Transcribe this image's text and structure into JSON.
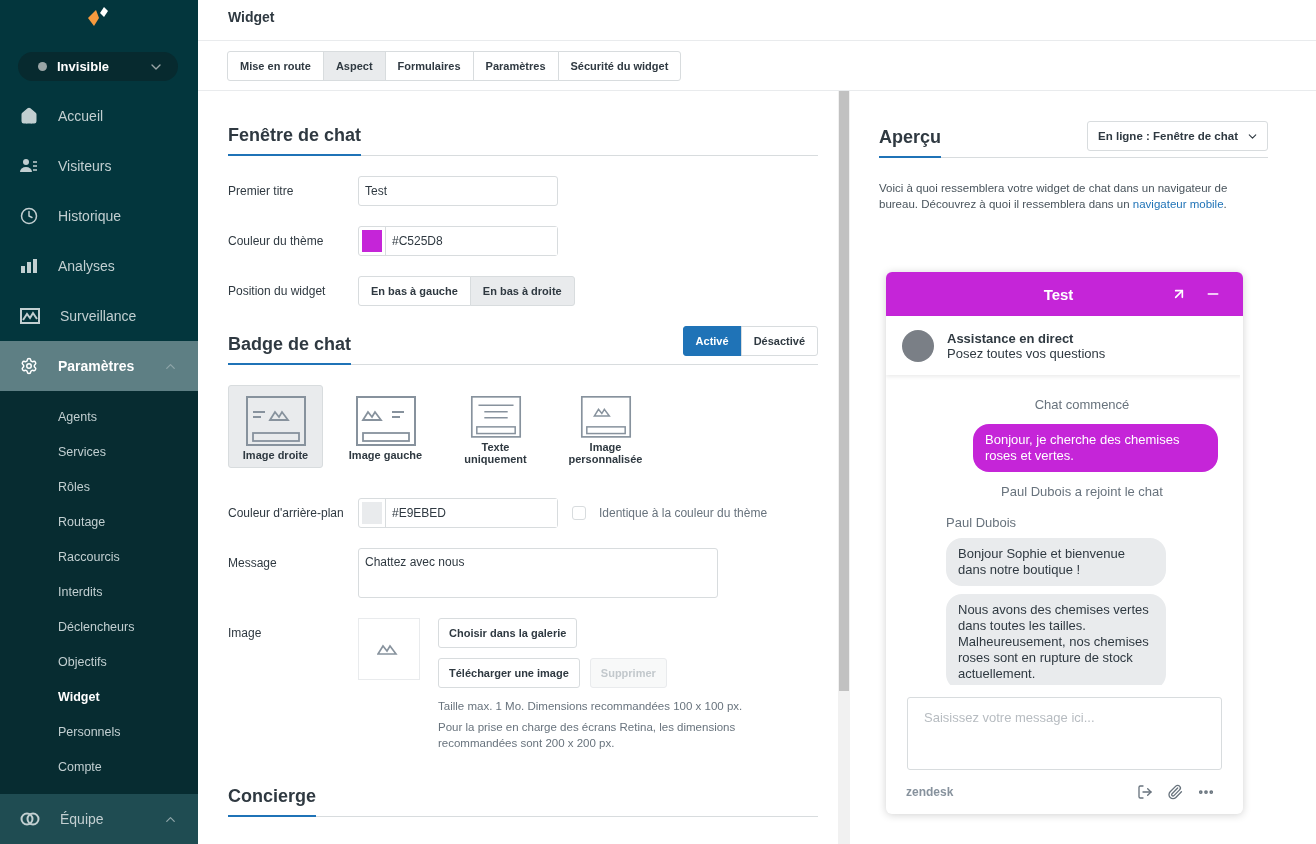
{
  "sidebar": {
    "status": {
      "label": "Invisible"
    },
    "items": [
      {
        "label": "Accueil",
        "kind": "home",
        "selected": false
      },
      {
        "label": "Visiteurs",
        "kind": "visitors",
        "selected": false
      },
      {
        "label": "Historique",
        "kind": "clock",
        "selected": false
      },
      {
        "label": "Analyses",
        "kind": "bars",
        "selected": false
      },
      {
        "label": "Surveillance",
        "kind": "monitor",
        "selected": false
      },
      {
        "label": "Paramètres",
        "kind": "gear",
        "selected": true,
        "expanded": true,
        "children": [
          {
            "label": "Agents",
            "selected": false
          },
          {
            "label": "Services",
            "selected": false
          },
          {
            "label": "Rôles",
            "selected": false
          },
          {
            "label": "Routage",
            "selected": false
          },
          {
            "label": "Raccourcis",
            "selected": false
          },
          {
            "label": "Interdits",
            "selected": false
          },
          {
            "label": "Déclencheurs",
            "selected": false
          },
          {
            "label": "Objectifs",
            "selected": false
          },
          {
            "label": "Widget",
            "selected": true
          },
          {
            "label": "Personnels",
            "selected": false
          },
          {
            "label": "Compte",
            "selected": false
          }
        ]
      },
      {
        "label": "Équipe",
        "kind": "rings",
        "selected": false,
        "expanded": true
      }
    ]
  },
  "page_title": "Widget",
  "tabs": [
    {
      "label": "Mise en route",
      "selected": false
    },
    {
      "label": "Aspect",
      "selected": true
    },
    {
      "label": "Formulaires",
      "selected": false
    },
    {
      "label": "Paramètres",
      "selected": false
    },
    {
      "label": "Sécurité du widget",
      "selected": false
    }
  ],
  "chat_window": {
    "title": "Fenêtre de chat",
    "fields": [
      {
        "kind": "text",
        "label": "Premier titre",
        "value": "Test"
      },
      {
        "kind": "color",
        "label": "Couleur du thème",
        "value": "#C525D8",
        "color": "#c525d8"
      },
      {
        "kind": "segmented",
        "label": "Position du widget",
        "options": [
          {
            "label": "En bas à gauche",
            "selected": false
          },
          {
            "label": "En bas à droite",
            "selected": true
          }
        ]
      }
    ]
  },
  "chat_badge": {
    "title": "Badge de chat",
    "toggle": [
      {
        "label": "Activé",
        "selected": true
      },
      {
        "label": "Désactivé",
        "selected": false
      }
    ],
    "layouts": [
      {
        "kind": "image-right",
        "label": "Image droite",
        "selected": true
      },
      {
        "kind": "image-left",
        "label": "Image gauche",
        "selected": false
      },
      {
        "kind": "text",
        "label": "Texte uniquement",
        "selected": false
      },
      {
        "kind": "custom",
        "label": "Image personnalisée",
        "selected": false
      }
    ],
    "background": {
      "label": "Couleur d'arrière-plan",
      "value": "#E9EBED",
      "color": "#e9ebed",
      "checkbox": {
        "label": "Identique à la couleur du thème",
        "checked": false
      }
    },
    "message": {
      "label": "Message",
      "value": "Chattez avec nous"
    },
    "image": {
      "label": "Image",
      "buttons": [
        {
          "label": "Choisir dans la galerie",
          "disabled": false
        },
        {
          "label": "Télécharger une image",
          "disabled": false
        },
        {
          "label": "Supprimer",
          "disabled": true
        }
      ],
      "notes": [
        "Taille max. 1 Mo. Dimensions recommandées 100 x 100 px.",
        "Pour la prise en charge des écrans Retina, les dimensions recommandées sont 200 x 200 px."
      ]
    }
  },
  "concierge": {
    "title": "Concierge"
  },
  "preview": {
    "title": "Aperçu",
    "select": "En ligne : Fenêtre de chat",
    "description": "Voici à quoi ressemblera votre widget de chat dans un navigateur de bureau. Découvrez à quoi il ressemblera dans un",
    "link": "navigateur mobile",
    "description_end": ".",
    "chat": {
      "title": "Test",
      "agent_name": "Assistance en direct",
      "agent_subtitle": "Posez toutes vos questions",
      "messages": [
        {
          "kind": "system",
          "text": "Chat commencé"
        },
        {
          "kind": "visitor",
          "text": "Bonjour, je cherche des chemises roses et vertes."
        },
        {
          "kind": "system",
          "text": "Paul Dubois a rejoint le chat"
        },
        {
          "kind": "name",
          "text": "Paul Dubois"
        },
        {
          "kind": "agent",
          "text": "Bonjour Sophie et bienvenue dans notre boutique !"
        },
        {
          "kind": "agent",
          "text": "Nous avons des chemises vertes dans toutes les tailles. Malheureusement, nos chemises roses sont en rupture de stock actuellement."
        }
      ],
      "placeholder": "Saisissez votre message ici...",
      "brand": "zendesk"
    }
  }
}
